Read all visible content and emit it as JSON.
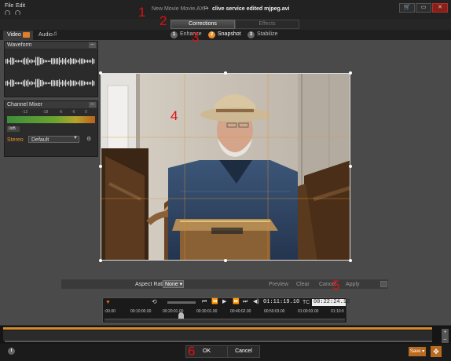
{
  "menu": {
    "file": "File",
    "edit": "Edit"
  },
  "title": {
    "project": "New Movie Movie.AXP",
    "file": "clive service edited mjpeg.avi"
  },
  "window_buttons": {
    "cart": "🛒",
    "restore": "▭",
    "close": "✕"
  },
  "main_tabs": [
    {
      "label": "Corrections",
      "active": true
    },
    {
      "label": "Effects",
      "active": false
    }
  ],
  "media_tabs": [
    {
      "label": "Video",
      "active": true
    },
    {
      "label": "Audio",
      "active": false
    }
  ],
  "steps": [
    {
      "num": "1",
      "label": "Enhance"
    },
    {
      "num": "2",
      "label": "Snapshot",
      "active": true
    },
    {
      "num": "3",
      "label": "Stabilize"
    }
  ],
  "panels": {
    "waveform": {
      "title": "Waveform",
      "min": "–"
    },
    "mixer": {
      "title": "Channel Mixer",
      "min": "–",
      "scale": [
        "-12",
        "-18",
        "-6",
        "-6",
        "0"
      ],
      "db": "0dB",
      "stereo_label": "Stereo",
      "mix_value": "Default",
      "settings_icon": "⚙"
    }
  },
  "aspect": {
    "label": "Aspect Ratio",
    "value": "None",
    "buttons": {
      "preview": "Preview",
      "clear": "Clear",
      "cancel": "Cancel",
      "apply": "Apply"
    }
  },
  "transport": {
    "marker": "▼",
    "loop": "⟲",
    "buttons": [
      "⏮",
      "⏪",
      "▶",
      "⏩",
      "⏭"
    ],
    "volume": "◀)",
    "timecode": "01:11:19.10",
    "tc_label": "TC",
    "total": "00:22:24.12",
    "ruler": [
      ":00.00",
      "00:10:00.00",
      "00:20:01.00",
      "00:30:01.00",
      "00:40:02.00",
      "00:50:03.00",
      "01:00:03.00",
      "01:10:0"
    ]
  },
  "timeline": {
    "zoom_in": "+",
    "zoom_out": "–"
  },
  "bottom": {
    "info": "i",
    "ok": "OK",
    "cancel": "Cancel",
    "save": "Save ▾",
    "tool": "✥"
  },
  "annotations": [
    "1",
    "2",
    "3",
    "4",
    "5",
    "6"
  ],
  "colors": {
    "accent": "#e8902a",
    "annotation": "#e01010",
    "close": "#8a1f17"
  }
}
